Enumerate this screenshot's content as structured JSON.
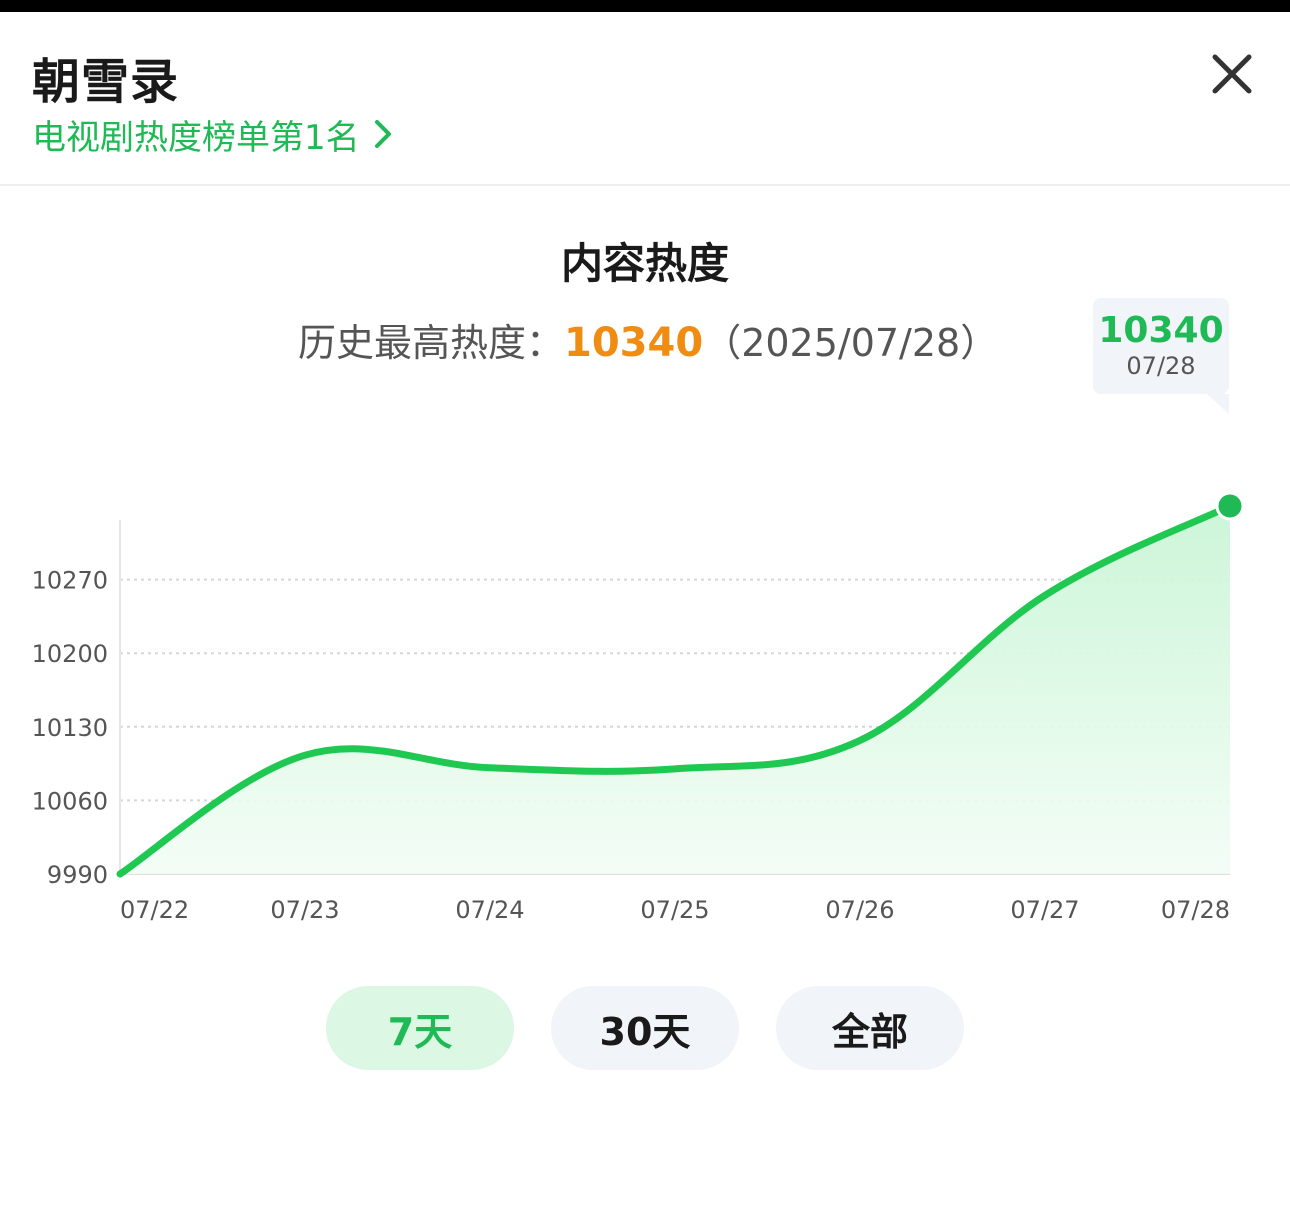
{
  "header": {
    "title": "朝雪录",
    "rank_link": "电视剧热度榜单第1名",
    "close_icon": "close-icon",
    "chevron_icon": "chevron-right-icon"
  },
  "chart_section": {
    "title": "内容热度",
    "peak_label": "历史最高热度：",
    "peak_value": "10340",
    "peak_date": "（2025/07/28）",
    "tooltip": {
      "value": "10340",
      "date": "07/28"
    }
  },
  "colors": {
    "accent": "#1fb955",
    "line": "#1ec851",
    "peak": "#f08c12",
    "tab_active_bg": "#ddf7e5",
    "tab_bg": "#f1f4f8"
  },
  "chart_data": {
    "type": "area",
    "title": "内容热度",
    "x": [
      "07/22",
      "07/23",
      "07/24",
      "07/25",
      "07/26",
      "07/27",
      "07/28"
    ],
    "y": [
      9990,
      10103,
      10091,
      10090,
      10117,
      10255,
      10340
    ],
    "yticks": [
      9990,
      10060,
      10130,
      10200,
      10270
    ],
    "ylim": [
      9990,
      10340
    ],
    "grid": true,
    "highlight": {
      "x": "07/28",
      "y": 10340
    }
  },
  "range_tabs": [
    {
      "label": "7天",
      "active": true
    },
    {
      "label": "30天",
      "active": false
    },
    {
      "label": "全部",
      "active": false
    }
  ]
}
